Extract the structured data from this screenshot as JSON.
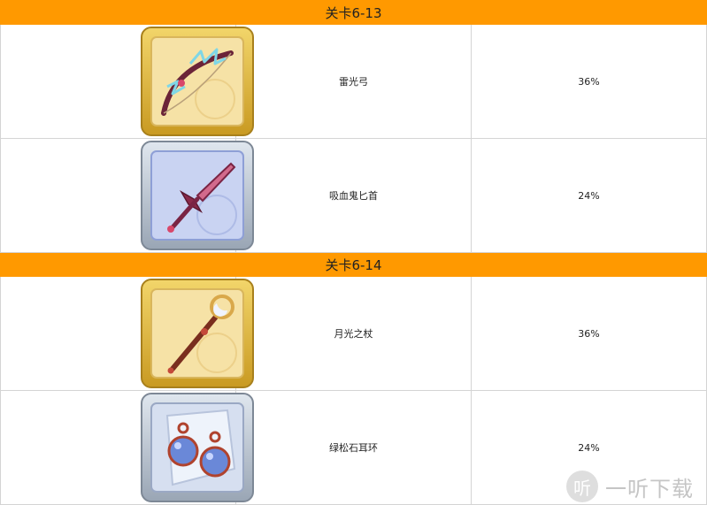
{
  "stages": [
    {
      "title": "关卡6-13",
      "items": [
        {
          "icon": "thunder-bow-icon",
          "frame": "gold",
          "name": "雷光弓",
          "rate": "36%"
        },
        {
          "icon": "vampire-dagger-icon",
          "frame": "silver",
          "name": "吸血鬼匕首",
          "rate": "24%"
        }
      ]
    },
    {
      "title": "关卡6-14",
      "items": [
        {
          "icon": "moonlight-staff-icon",
          "frame": "gold",
          "name": "月光之杖",
          "rate": "36%"
        },
        {
          "icon": "turquoise-earrings-icon",
          "frame": "silver",
          "name": "绿松石耳环",
          "rate": "24%"
        }
      ]
    }
  ],
  "watermark": {
    "logo": "听",
    "text": "一听下载"
  },
  "colors": {
    "header_bg": "#ff9900",
    "border": "#d4d4d4",
    "gold_frame": "#e2b63a",
    "silver_frame": "#aab4c0"
  }
}
